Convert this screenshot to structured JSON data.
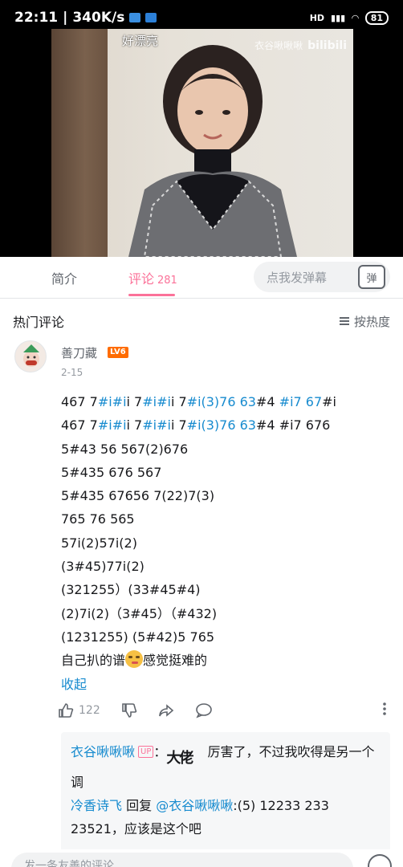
{
  "status_bar": {
    "time": "22:11",
    "speed": "340K/s",
    "signal_text": "HD",
    "battery": "81"
  },
  "video": {
    "danmaku_text": "好漂亮",
    "watermark_user": "衣谷啾啾啾",
    "watermark_brand": "bilibili"
  },
  "tabs": {
    "intro": "简介",
    "comments": "评论",
    "comments_count": "281",
    "danmaku_placeholder": "点我发弹幕",
    "danmaku_button": "弹"
  },
  "hot": {
    "title": "热门评论",
    "sort_label": "按热度"
  },
  "comment": {
    "username": "善刀藏",
    "level": "LV6",
    "date": "2-15",
    "lines": [
      [
        {
          "t": "467 7"
        },
        {
          "t": "#i#i",
          "h": true
        },
        {
          "t": "i 7"
        },
        {
          "t": "#i#i",
          "h": true
        },
        {
          "t": "i 7"
        },
        {
          "t": "#i(3)76 63",
          "h": true
        },
        {
          "t": "#4 "
        },
        {
          "t": "#i7 67",
          "h": true
        },
        {
          "t": "#i"
        }
      ],
      [
        {
          "t": "467 7"
        },
        {
          "t": "#i#i",
          "h": true
        },
        {
          "t": "i 7"
        },
        {
          "t": "#i#i",
          "h": true
        },
        {
          "t": "i 7"
        },
        {
          "t": "#i(3)76 63",
          "h": true
        },
        {
          "t": "#4 #i7 676"
        }
      ],
      [
        {
          "t": "5#43 56 567(2)676"
        }
      ],
      [
        {
          "t": "5#435 676 567"
        }
      ],
      [
        {
          "t": "5#435 67656 7(22)7(3)"
        }
      ],
      [
        {
          "t": "765 76 565"
        }
      ],
      [
        {
          "t": "57i(2)57i(2)"
        }
      ],
      [
        {
          "t": "(3#45)77i(2)"
        }
      ],
      [
        {
          "t": "(321255）(33#45#4)"
        }
      ],
      [
        {
          "t": "(2)7i(2)（3#45）（#432)"
        }
      ],
      [
        {
          "t": " (1231255) (5#42)5 765"
        }
      ]
    ],
    "closing_before": "自己扒的谱",
    "closing_after": "感觉挺难的",
    "collapse": "收起",
    "likes": "122"
  },
  "replies": [
    {
      "name": "衣谷啾啾啾",
      "up_tag": "UP",
      "sticker": "大佬",
      "text": "厉害了，不过我吹得是另一个调"
    },
    {
      "name": "冷香诗飞",
      "reply_word": "回复",
      "mention": "@衣谷啾啾啾",
      "text": ":(5) 12233  233 23521，应该是这个吧"
    }
  ],
  "bottom": {
    "placeholder": "发一条友善的评论"
  }
}
